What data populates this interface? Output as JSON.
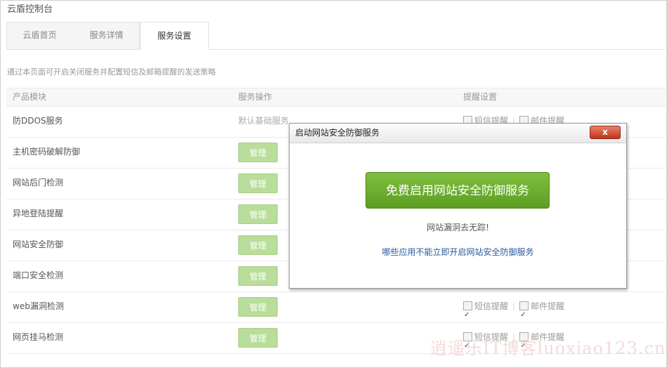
{
  "app": {
    "title": "云盾控制台"
  },
  "tabs": [
    {
      "label": "云盾首页"
    },
    {
      "label": "服务详情"
    },
    {
      "label": "服务设置"
    }
  ],
  "description": "通过本页面可开启关闭服务并配置短信及邮箱提醒的发送策略",
  "table": {
    "headers": [
      "产品模块",
      "服务操作",
      "提醒设置"
    ],
    "rows": [
      {
        "name": "防DDOS服务",
        "operation": "默认基础服务"
      },
      {
        "name": "主机密码破解防御",
        "operation": "管理"
      },
      {
        "name": "网站后门检测",
        "operation": "管理"
      },
      {
        "name": "异地登陆提醒",
        "operation": "管理"
      },
      {
        "name": "网站安全防御",
        "operation": "管理"
      },
      {
        "name": "端口安全检测",
        "operation": "管理"
      },
      {
        "name": "web漏洞检测",
        "operation": "管理"
      },
      {
        "name": "网页挂马检测",
        "operation": "管理"
      }
    ],
    "sms_label": "短信提醒",
    "email_label": "邮件提醒",
    "separator": "|"
  },
  "dialog": {
    "title": "启动网站安全防御服务",
    "close_label": "x",
    "cta_label": "免费启用网站安全防御服务",
    "tagline": "网站漏洞去无踪!",
    "help_link": "哪些应用不能立即开启网站安全防御服务"
  },
  "watermark": "逍遥乐IT博客luoxiao123.cn",
  "colors": {
    "cta_green": "#6aad2e",
    "manage_button": "#b9dd9a",
    "link_blue": "#2a5b9e",
    "close_red": "#c3331a"
  }
}
